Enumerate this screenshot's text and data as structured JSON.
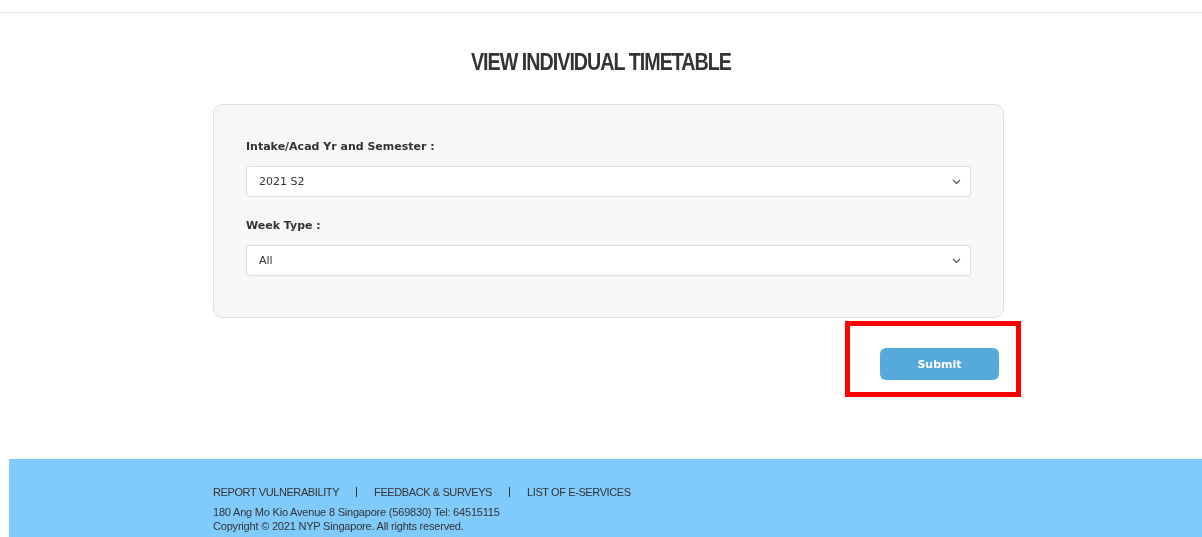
{
  "title": "VIEW INDIVIDUAL TIMETABLE",
  "fields": [
    {
      "label": "Intake/Acad Yr and Semester :",
      "value": "2021 S2"
    },
    {
      "label": "Week Type :",
      "value": "All"
    }
  ],
  "submit": {
    "label": "Submit",
    "highlighted": true
  },
  "footer": {
    "links": [
      "REPORT VULNERABILITY",
      "FEEDBACK & SURVEYS",
      "LIST OF E-SERVICES"
    ],
    "address": "180 Ang Mo Kio Avenue 8 Singapore (569830) Tel: 64515115",
    "copyright": "Copyright © 2021 NYP Singapore. All rights reserved."
  }
}
